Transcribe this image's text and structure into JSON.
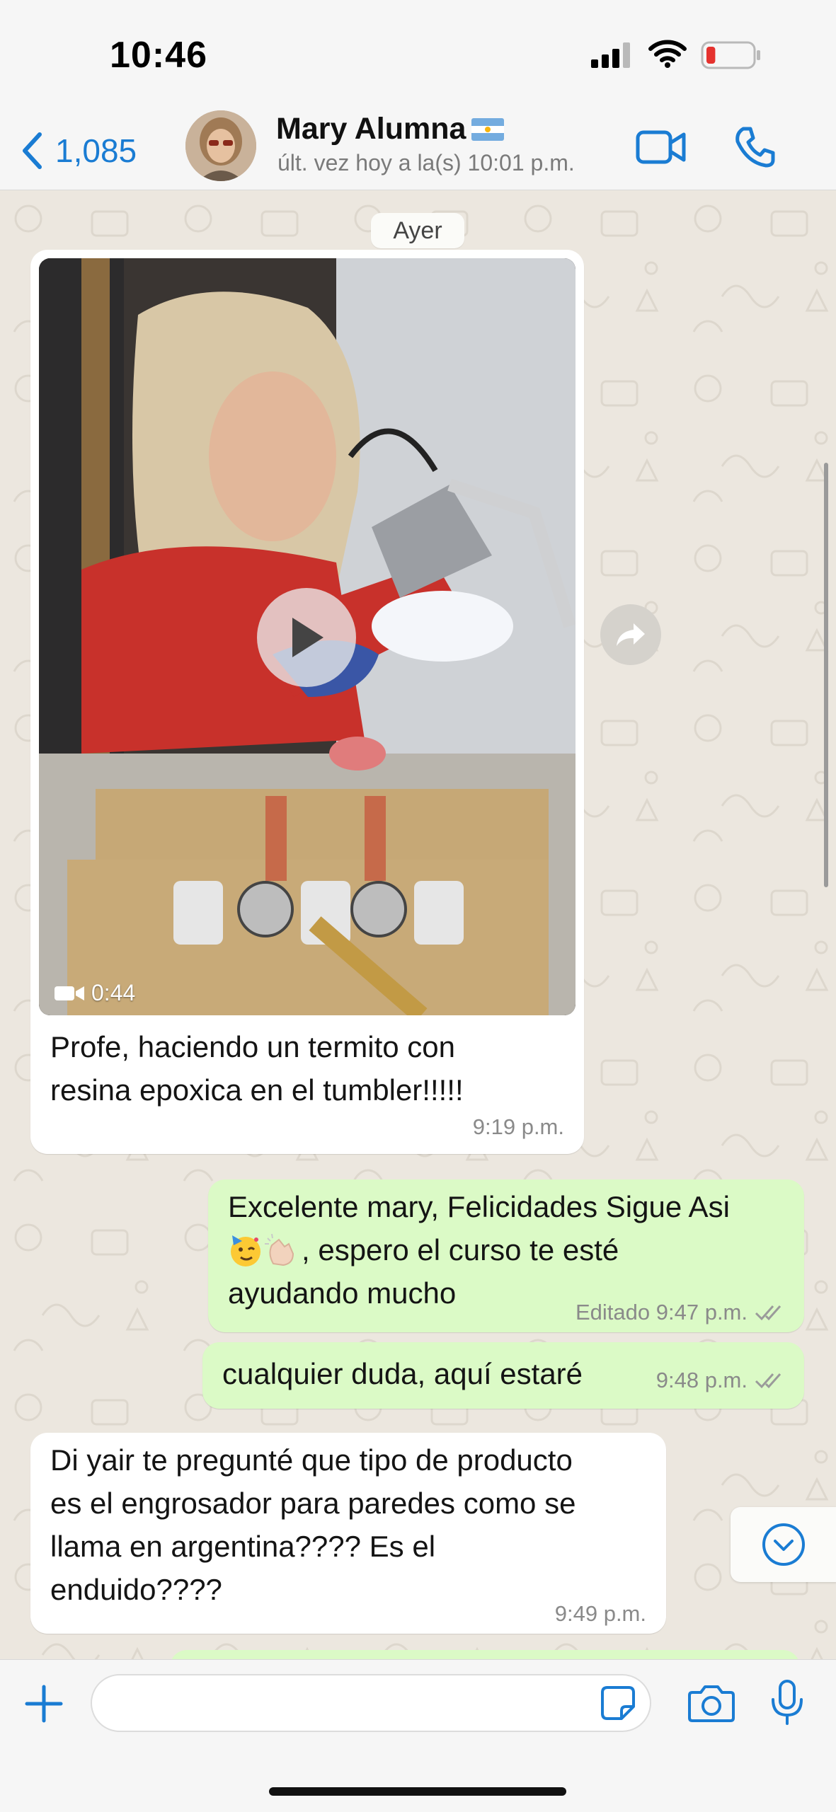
{
  "status_bar": {
    "time": "10:46",
    "battery_level": 0.2
  },
  "header": {
    "back_label": "1,085",
    "contact_name": "Mary Alumna",
    "last_seen": "últ. vez hoy a la(s) 10:01 p.m."
  },
  "chat": {
    "date_divider": "Ayer",
    "messages": [
      {
        "direction": "in",
        "type": "video",
        "duration": "0:44",
        "text_line1": "Profe, haciendo un termito con",
        "text_line2": "resina epoxica en el tumbler!!!!!",
        "time": "9:19 p.m."
      },
      {
        "direction": "out",
        "text_line1": "Excelente mary, Felicidades Sigue Asi",
        "text_line2": ", espero el curso te esté",
        "text_line3": "ayudando mucho",
        "emojis": "🥳👏🏻",
        "time": "Editado 9:47 p.m."
      },
      {
        "direction": "out",
        "text": "cualquier duda, aquí estaré",
        "time": "9:48 p.m."
      },
      {
        "direction": "in",
        "text_line1": "Di yair te pregunté que tipo de producto",
        "text_line2": "es el engrosador para paredes como se",
        "text_line3": "llama en argentina???? Es el",
        "text_line4": "enduido????",
        "time": "9:49 p.m."
      }
    ]
  },
  "composer": {
    "placeholder": ""
  },
  "colors": {
    "accent": "#1a7cd3",
    "outgoing_bubble": "#dbfac6",
    "incoming_bubble": "#ffffff",
    "chat_background": "#ece7df"
  },
  "icons": [
    "signal-icon",
    "wifi-icon",
    "battery-icon",
    "chevron-left-icon",
    "flag-argentina-icon",
    "video-camera-icon",
    "phone-icon",
    "play-icon",
    "video-duration-icon",
    "forward-icon",
    "double-check-icon",
    "chevron-down-icon",
    "plus-icon",
    "sticker-icon",
    "camera-icon",
    "microphone-icon"
  ]
}
